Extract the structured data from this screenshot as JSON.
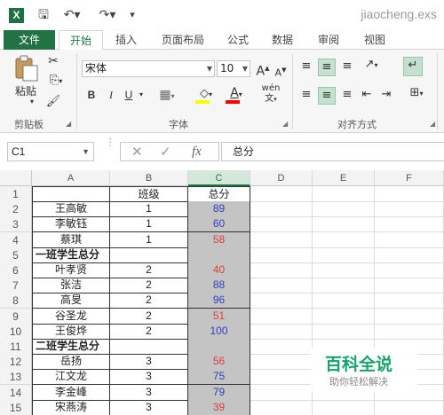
{
  "window": {
    "title": "jiaocheng.exs"
  },
  "tabs": [
    "文件",
    "开始",
    "插入",
    "页面布局",
    "公式",
    "数据",
    "审阅",
    "视图"
  ],
  "ribbon": {
    "clipboard": {
      "paste_label": "粘贴",
      "group_label": "剪贴板"
    },
    "font": {
      "family": "宋体",
      "size": "10",
      "bold": "B",
      "italic": "I",
      "underline": "U",
      "grow": "A",
      "shrink": "A",
      "font_color_letter": "A",
      "phonetic": "wén",
      "group_label": "字体"
    },
    "alignment": {
      "group_label": "对齐方式"
    }
  },
  "formula_bar": {
    "name_box": "C1",
    "fx": "fx",
    "content": "总分"
  },
  "columns": [
    "A",
    "B",
    "C",
    "D",
    "E",
    "F"
  ],
  "rows": [
    {
      "n": "1",
      "a": "",
      "b": "班级",
      "c": "总分",
      "kind": "header"
    },
    {
      "n": "2",
      "a": "王高敏",
      "b": "1",
      "c": "89",
      "color": "blue"
    },
    {
      "n": "3",
      "a": "李敏钰",
      "b": "1",
      "c": "60",
      "color": "blue"
    },
    {
      "n": "4",
      "a": "蔡琪",
      "b": "1",
      "c": "58",
      "color": "red"
    },
    {
      "n": "5",
      "a": "一班学生总分",
      "b": "",
      "c": "",
      "kind": "subtotal"
    },
    {
      "n": "6",
      "a": "叶孝贤",
      "b": "2",
      "c": "40",
      "color": "red"
    },
    {
      "n": "7",
      "a": "张洁",
      "b": "2",
      "c": "88",
      "color": "blue"
    },
    {
      "n": "8",
      "a": "高旻",
      "b": "2",
      "c": "96",
      "color": "blue"
    },
    {
      "n": "9",
      "a": "谷圣龙",
      "b": "2",
      "c": "51",
      "color": "red"
    },
    {
      "n": "10",
      "a": "王俊烨",
      "b": "2",
      "c": "100",
      "color": "blue"
    },
    {
      "n": "11",
      "a": "二班学生总分",
      "b": "",
      "c": "",
      "kind": "subtotal"
    },
    {
      "n": "12",
      "a": "岳扬",
      "b": "3",
      "c": "56",
      "color": "red"
    },
    {
      "n": "13",
      "a": "江文龙",
      "b": "3",
      "c": "75",
      "color": "blue"
    },
    {
      "n": "14",
      "a": "李金峰",
      "b": "3",
      "c": "79",
      "color": "blue"
    },
    {
      "n": "15",
      "a": "宋燕涛",
      "b": "3",
      "c": "39",
      "color": "red"
    }
  ],
  "colors": {
    "accent": "#217346",
    "low_score": "#e03c3c",
    "high_score": "#2f3fc0",
    "selected_column_fill": "#c4c4c4"
  },
  "watermark": {
    "title": "百科全说",
    "subtitle": "助你轻松解决"
  }
}
